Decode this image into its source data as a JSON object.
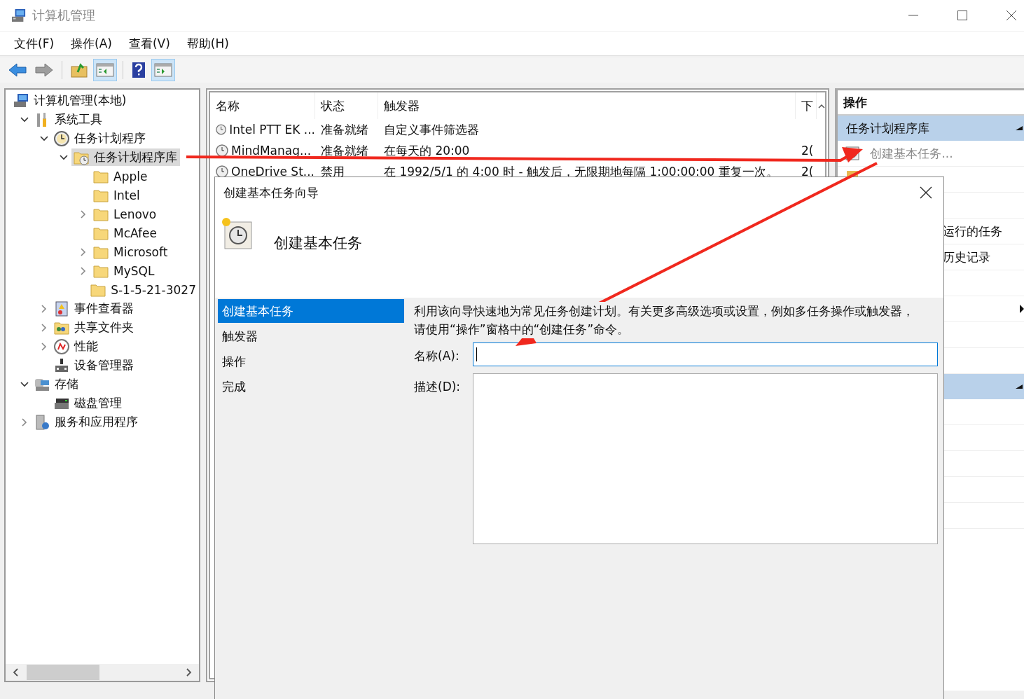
{
  "window": {
    "title": "计算机管理"
  },
  "menu": [
    "文件(F)",
    "操作(A)",
    "查看(V)",
    "帮助(H)"
  ],
  "toolbar": [
    {
      "kind": "back",
      "disabled": false,
      "pressed": false
    },
    {
      "kind": "forward",
      "disabled": true,
      "pressed": false
    },
    {
      "kind": "up",
      "disabled": false,
      "pressed": false
    },
    {
      "kind": "tree",
      "disabled": false,
      "pressed": true
    },
    {
      "kind": "help",
      "disabled": false,
      "pressed": false
    },
    {
      "kind": "pane",
      "disabled": false,
      "pressed": true
    }
  ],
  "tree": [
    {
      "label": "计算机管理(本地)",
      "kind": "computer",
      "selected": false,
      "children": [
        {
          "label": "系统工具",
          "kind": "tools",
          "expanded": true,
          "selected": false,
          "children": [
            {
              "label": "任务计划程序",
              "kind": "clock",
              "expanded": true,
              "selected": false,
              "children": [
                {
                  "label": "任务计划程序库",
                  "kind": "clock-folder",
                  "expanded": true,
                  "selected": true,
                  "children": [
                    {
                      "label": "Apple",
                      "kind": "folder",
                      "selected": false
                    },
                    {
                      "label": "Intel",
                      "kind": "folder",
                      "selected": false
                    },
                    {
                      "label": "Lenovo",
                      "kind": "folder",
                      "expanded": false,
                      "selected": false
                    },
                    {
                      "label": "McAfee",
                      "kind": "folder",
                      "selected": false
                    },
                    {
                      "label": "Microsoft",
                      "kind": "folder",
                      "expanded": false,
                      "selected": false
                    },
                    {
                      "label": "MySQL",
                      "kind": "folder",
                      "expanded": false,
                      "selected": false
                    },
                    {
                      "label": "S-1-5-21-3027",
                      "kind": "folder",
                      "selected": false
                    }
                  ]
                }
              ]
            },
            {
              "label": "事件查看器",
              "kind": "event-log",
              "expanded": false,
              "selected": false
            },
            {
              "label": "共享文件夹",
              "kind": "shared-folder",
              "expanded": false,
              "selected": false
            },
            {
              "label": "性能",
              "kind": "performance",
              "expanded": false,
              "selected": false
            },
            {
              "label": "设备管理器",
              "kind": "device",
              "selected": false
            }
          ]
        },
        {
          "label": "存储",
          "kind": "storage",
          "expanded": true,
          "selected": false,
          "children": [
            {
              "label": "磁盘管理",
              "kind": "disk",
              "selected": false
            }
          ]
        },
        {
          "label": "服务和应用程序",
          "kind": "services",
          "expanded": false,
          "selected": false
        }
      ]
    }
  ],
  "table": {
    "columns": [
      "名称",
      "状态",
      "触发器",
      "下"
    ],
    "rows": [
      [
        "Intel PTT EK ...",
        "准备就绪",
        "自定义事件筛选器",
        ""
      ],
      [
        "MindManag...",
        "准备就绪",
        "在每天的 20:00",
        "2("
      ],
      [
        "OneDrive St...",
        "禁用",
        "在 1992/5/1 的 4:00 时 - 触发后，无限期地每隔 1:00:00:00 重复一次。",
        "2("
      ]
    ]
  },
  "actions": {
    "title": "操作",
    "sections": [
      {
        "title": "任务计划程序库",
        "expanded": true,
        "items": [
          {
            "kind": "action",
            "label": "创建基本任务..."
          },
          {
            "kind": "covered"
          },
          {
            "kind": "blank"
          },
          {
            "kind": "partial",
            "label": "运行的任务"
          },
          {
            "kind": "partial",
            "label": "历史记录"
          },
          {
            "kind": "blank"
          },
          {
            "kind": "submenu"
          },
          {
            "kind": "blank"
          },
          {
            "kind": "blank"
          }
        ]
      },
      {
        "expanded": true,
        "items": [
          {
            "kind": "blank"
          },
          {
            "kind": "blank"
          },
          {
            "kind": "blank"
          },
          {
            "kind": "blank"
          },
          {
            "kind": "blank"
          }
        ]
      }
    ]
  },
  "dialog": {
    "title": "创建基本任务向导",
    "heading": "创建基本任务",
    "steps": [
      {
        "label": "创建基本任务",
        "selected": true
      },
      {
        "label": "触发器",
        "selected": false
      },
      {
        "label": "操作",
        "selected": false
      },
      {
        "label": "完成",
        "selected": false
      }
    ],
    "description": "利用该向导快速地为常见任务创建计划。有关更多高级选项或设置，例如多任务操作或触发器，请使用“操作”窗格中的“创建任务”命令。",
    "fields": [
      {
        "kind": "line",
        "label": "名称(A):",
        "focused": true
      },
      {
        "kind": "area",
        "label": "描述(D):",
        "focused": false
      }
    ]
  }
}
